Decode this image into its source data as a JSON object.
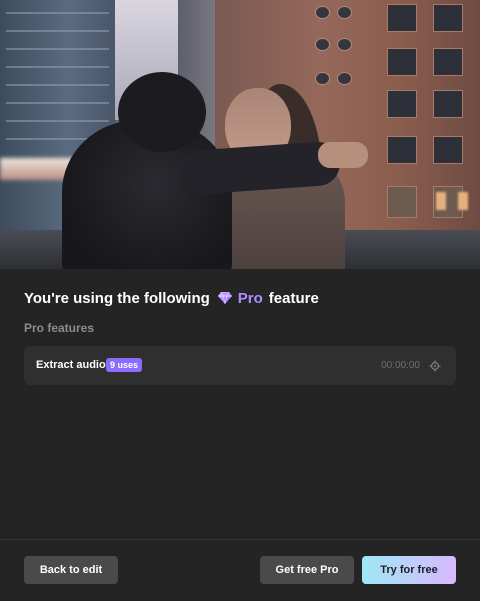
{
  "header": {
    "title_prefix": "You're using the following",
    "pro_label": "Pro",
    "title_suffix": "feature"
  },
  "section": {
    "label": "Pro features"
  },
  "features": [
    {
      "name": "Extract audio",
      "uses_badge": "9 uses",
      "duration": "00:00:00",
      "icon": "locate-icon"
    }
  ],
  "footer": {
    "back_label": "Back to edit",
    "get_free_pro_label": "Get free Pro",
    "try_free_label": "Try for free"
  },
  "colors": {
    "background": "#242424",
    "accent_pro": "#b08cff",
    "badge": "#8b6cff",
    "try_gradient_start": "#9fe8f4",
    "try_gradient_end": "#d9b8ff"
  }
}
